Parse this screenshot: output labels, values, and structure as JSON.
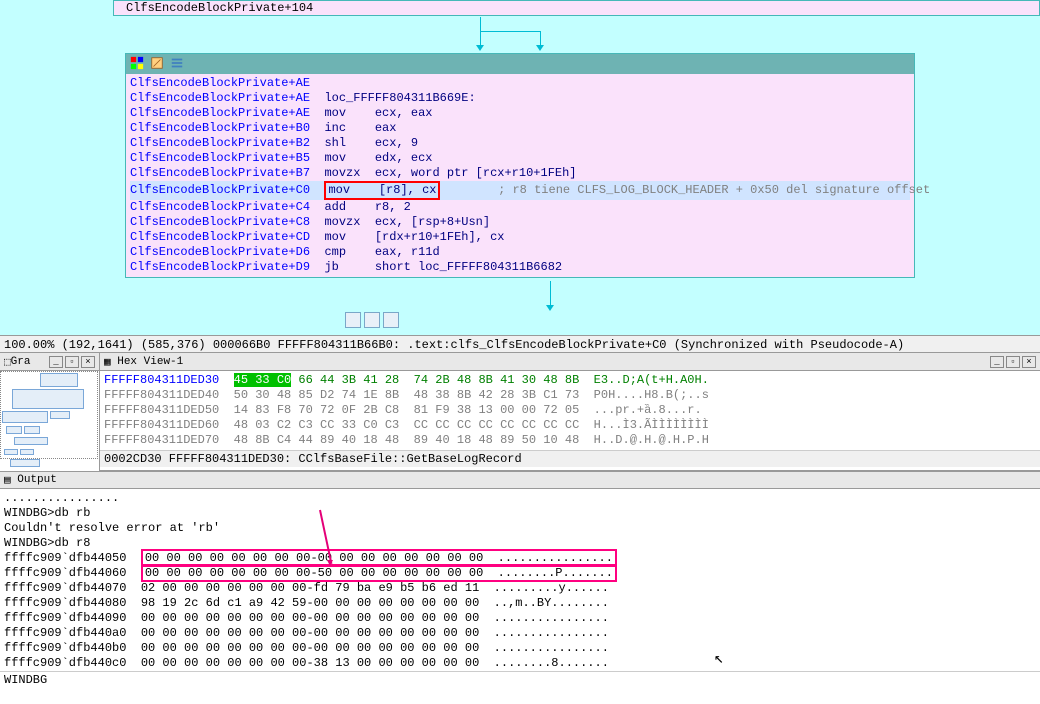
{
  "topBlock": "ClfsEncodeBlockPrivate+104",
  "codeHeader": {
    "icons": [
      "palette-icon",
      "edit-icon",
      "list-icon"
    ]
  },
  "codeLines": [
    {
      "addr": "ClfsEncodeBlockPrivate+AE",
      "rest": ""
    },
    {
      "addr": "ClfsEncodeBlockPrivate+AE",
      "loc": "loc_FFFFF804311B669E:"
    },
    {
      "addr": "ClfsEncodeBlockPrivate+AE",
      "mnem": "mov",
      "ops": "ecx, eax"
    },
    {
      "addr": "ClfsEncodeBlockPrivate+B0",
      "mnem": "inc",
      "ops": "eax"
    },
    {
      "addr": "ClfsEncodeBlockPrivate+B2",
      "mnem": "shl",
      "ops": "ecx, 9",
      "num": "9"
    },
    {
      "addr": "ClfsEncodeBlockPrivate+B5",
      "mnem": "mov",
      "ops": "edx, ecx"
    },
    {
      "addr": "ClfsEncodeBlockPrivate+B7",
      "mnem": "movzx",
      "ops": "ecx, word ptr [rcx+r10+1FEh]",
      "num": "1FEh"
    },
    {
      "addr": "ClfsEncodeBlockPrivate+C0",
      "mnem": "mov",
      "ops": "[r8], cx",
      "hl": true,
      "box": true,
      "comment": "; r8 tiene CLFS_LOG_BLOCK_HEADER + 0x50 del signature offset"
    },
    {
      "addr": "ClfsEncodeBlockPrivate+C4",
      "mnem": "add",
      "ops": "r8, 2",
      "num": "2"
    },
    {
      "addr": "ClfsEncodeBlockPrivate+C8",
      "mnem": "movzx",
      "ops": "ecx, [rsp+8+Usn]",
      "num": "8"
    },
    {
      "addr": "ClfsEncodeBlockPrivate+CD",
      "mnem": "mov",
      "ops": "[rdx+r10+1FEh], cx",
      "num": "1FEh"
    },
    {
      "addr": "ClfsEncodeBlockPrivate+D6",
      "mnem": "cmp",
      "ops": "eax, r11d"
    },
    {
      "addr": "ClfsEncodeBlockPrivate+D9",
      "mnem": "jb",
      "ops": "short loc_FFFFF804311B6682"
    }
  ],
  "statusBar": "100.00% (192,1641) (585,376) 000066B0 FFFFF804311B66B0: .text:clfs_ClfsEncodeBlockPrivate+C0 (Synchronized with Pseudocode-A)",
  "graphOverview": {
    "title": "Gra"
  },
  "hexView": {
    "title": "Hex View-1",
    "rows": [
      {
        "addr": "FFFFF804311DED30",
        "blue": true,
        "b": "45 33 C0",
        "rest": " 66 44 3B 41 28  74 2B 48 8B 41 30 48 8B  E3..D;A(t+H.A0H.",
        "sel": "45 33 C0"
      },
      {
        "addr": "FFFFF804311DED40",
        "b": "50 30 48 85 D2 74 1E 8B  48 38 8B 42 28 3B C1 73  P0H....H8.B(;..s"
      },
      {
        "addr": "FFFFF804311DED50",
        "b": "14 83 F8 70 72 0F 2B C8  81 F9 38 13 00 00 72 05  ...pr.+ȁ.8...r."
      },
      {
        "addr": "FFFFF804311DED60",
        "b": "48 03 C2 C3 CC 33 C0 C3  CC CC CC CC CC CC CC CC  H...Ì3.ÃÌÌÌÌÌÌÌÌ"
      },
      {
        "addr": "FFFFF804311DED70",
        "b": "48 8B C4 44 89 40 18 48  89 40 18 48 89 50 10 48  H..D.@.H.@.H.P.H"
      }
    ],
    "status": "0002CD30 FFFFF804311DED30: CClfsBaseFile::GetBaseLogRecord"
  },
  "output": {
    "title": "Output",
    "lines": [
      "WINDBG>db rb",
      "Couldn't resolve error at 'rb'",
      "WINDBG>db r8",
      "ffffc909`dfb44050  00 00 00 00 00 00 00 00-00 00 00 00 00 00 00 00  ................",
      "ffffc909`dfb44060  00 00 00 00 00 00 00 00-50 00 00 00 00 00 00 00  ........P.......",
      "ffffc909`dfb44070  02 00 00 00 00 00 00 00-fd 79 ba e9 b5 b6 ed 11  .........y......",
      "ffffc909`dfb44080  98 19 2c 6d c1 a9 42 59-00 00 00 00 00 00 00 00  ..,m..BY........",
      "ffffc909`dfb44090  00 00 00 00 00 00 00 00-00 00 00 00 00 00 00 00  ................",
      "ffffc909`dfb440a0  00 00 00 00 00 00 00 00-00 00 00 00 00 00 00 00  ................",
      "ffffc909`dfb440b0  00 00 00 00 00 00 00 00-00 00 00 00 00 00 00 00  ................",
      "ffffc909`dfb440c0  00 00 00 00 00 00 00 00-38 13 00 00 00 00 00 00  ........8......."
    ],
    "inputLabel": "WINDBG",
    "inputValue": ""
  }
}
